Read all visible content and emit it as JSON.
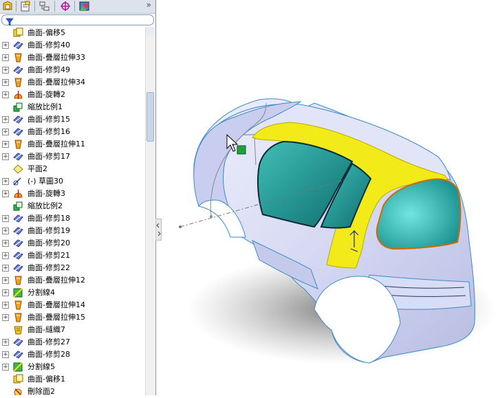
{
  "window": {
    "feature_manager_tabs": [
      "feature-tree-tab-icon",
      "property-manager-tab-icon",
      "configuration-manager-tab-icon",
      "dimxpert-tab-icon",
      "display-manager-tab-icon"
    ],
    "more_glyph": "»"
  },
  "filter": {
    "icon": "filter-icon"
  },
  "tree": {
    "items": [
      {
        "label": "曲面-偏移5",
        "icon": "offset-surface-icon",
        "expand": false
      },
      {
        "label": "曲面-修剪40",
        "icon": "trim-surface-icon",
        "expand": true
      },
      {
        "label": "曲面-疊層拉伸33",
        "icon": "loft-surface-icon",
        "expand": true
      },
      {
        "label": "曲面-修剪49",
        "icon": "trim-surface-icon",
        "expand": true
      },
      {
        "label": "曲面-疊層拉伸34",
        "icon": "loft-surface-icon",
        "expand": true
      },
      {
        "label": "曲面-旋轉2",
        "icon": "revolve-surface-icon",
        "expand": true
      },
      {
        "label": "縮放比例1",
        "icon": "scale-icon",
        "expand": false
      },
      {
        "label": "曲面-修剪15",
        "icon": "trim-surface-icon",
        "expand": true
      },
      {
        "label": "曲面-修剪16",
        "icon": "trim-surface-icon",
        "expand": true
      },
      {
        "label": "曲面-疊層拉伸11",
        "icon": "loft-surface-icon",
        "expand": true
      },
      {
        "label": "曲面-修剪17",
        "icon": "trim-surface-icon",
        "expand": true
      },
      {
        "label": "平面2",
        "icon": "plane-icon",
        "expand": false
      },
      {
        "label": "(-) 草圖30",
        "icon": "sketch-icon",
        "expand": true
      },
      {
        "label": "曲面-旋轉3",
        "icon": "revolve-surface-icon",
        "expand": true
      },
      {
        "label": "縮放比例2",
        "icon": "scale-icon",
        "expand": false
      },
      {
        "label": "曲面-修剪18",
        "icon": "trim-surface-icon",
        "expand": true
      },
      {
        "label": "曲面-修剪19",
        "icon": "trim-surface-icon",
        "expand": true
      },
      {
        "label": "曲面-修剪20",
        "icon": "trim-surface-icon",
        "expand": true
      },
      {
        "label": "曲面-修剪21",
        "icon": "trim-surface-icon",
        "expand": true
      },
      {
        "label": "曲面-修剪22",
        "icon": "trim-surface-icon",
        "expand": true
      },
      {
        "label": "曲面-疊層拉伸12",
        "icon": "loft-surface-icon",
        "expand": true
      },
      {
        "label": "分割線4",
        "icon": "split-line-icon",
        "expand": true
      },
      {
        "label": "曲面-疊層拉伸14",
        "icon": "loft-surface-icon",
        "expand": true
      },
      {
        "label": "曲面-疊層拉伸15",
        "icon": "loft-surface-icon",
        "expand": true
      },
      {
        "label": "曲面-縫織7",
        "icon": "knit-surface-icon",
        "expand": false
      },
      {
        "label": "曲面-修剪27",
        "icon": "trim-surface-icon",
        "expand": true
      },
      {
        "label": "曲面-修剪28",
        "icon": "trim-surface-icon",
        "expand": true
      },
      {
        "label": "分割線5",
        "icon": "split-line-icon",
        "expand": true
      },
      {
        "label": "曲面-偏移1",
        "icon": "offset-surface-icon",
        "expand": false
      },
      {
        "label": "刪除面2",
        "icon": "delete-face-icon",
        "expand": false
      }
    ]
  },
  "colors": {
    "selection_yellow": "#f2ea19",
    "body_lavender": "#d9dcf5",
    "glass_teal": "#1b9e98",
    "edge_blue": "#3a8ac8"
  }
}
